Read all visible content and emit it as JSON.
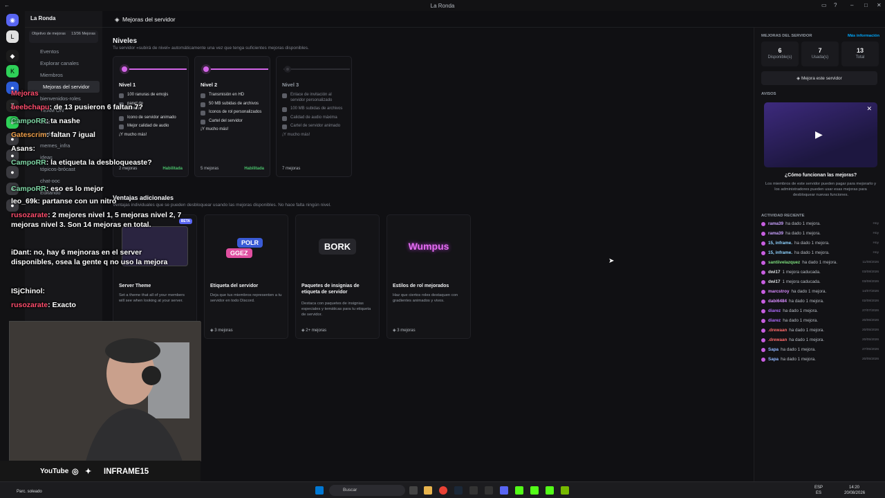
{
  "window": {
    "title": "La Ronda"
  },
  "rail": {
    "badge": "187"
  },
  "sidebar": {
    "server_name": "La Ronda",
    "goal_label": "Objetivo de mejoras",
    "goal_count": "13/36",
    "goal_unit": "Mejoras",
    "items": [
      "Eventos",
      "Explorar canales",
      "Miembros",
      "Mejoras del servidor",
      "bienvenidos-roles",
      "TEAM ON",
      "chat",
      "mods",
      "memes_infra",
      "ideas",
      "tópicos-brócast",
      "chat-ooc",
      "Editando"
    ]
  },
  "topbar": {
    "title": "Mejoras del servidor"
  },
  "levels_section": {
    "title": "Niveles",
    "subtitle": "Tu servidor «subirá de nivel» automáticamente una vez que tenga suficientes mejoras disponibles."
  },
  "levels": [
    {
      "name": "Nivel 1",
      "perks": [
        "100 ranuras de emojis",
        "sonidos",
        "Icono de servidor animado",
        "Mejor calidad de audio",
        "¡Y mucho más!"
      ],
      "perk_extra": "panel de",
      "cost": "2 mejoras",
      "status": "Habilitada"
    },
    {
      "name": "Nivel 2",
      "perks": [
        "Transmisión en HD",
        "50 MB subidas de archivos",
        "Iconos de rol personalizados",
        "Cartel del servidor",
        "¡Y mucho más!"
      ],
      "cost": "5 mejoras",
      "status": "Habilitada"
    },
    {
      "name": "Nivel 3",
      "perks": [
        "Enlace de invitación al servidor personalizado",
        "100 MB subidas de archivos",
        "Calidad de audio máxima",
        "Cartel de servidor animado",
        "¡Y mucho más!"
      ],
      "cost": "7 mejoras",
      "status": ""
    }
  ],
  "perks_section": {
    "title": "Ventajas adicionales",
    "subtitle": "Ventajas individuales que se pueden desbloquear usando las mejoras disponibles. No hace falta ningún nivel."
  },
  "perks": [
    {
      "title": "Server Theme",
      "desc": "Set a theme that all of your members will see when looking at your server.",
      "cost": "",
      "badge": "BETA"
    },
    {
      "title": "Etiqueta del servidor",
      "desc": "Deja que tus miembros representen a tu servidor en todo Discord.",
      "cost": "3 mejoras",
      "art": [
        "POLR",
        "GGEZ"
      ]
    },
    {
      "title": "Paquetes de insignias de etiqueta de servidor",
      "desc": "Destaca con paquetes de insignias especiales y temáticas para tu etiqueta de servidor.",
      "cost": "2+ mejoras",
      "art": [
        "BORK"
      ]
    },
    {
      "title": "Estilos de rol mejorados",
      "desc": "Haz que ciertos roles destaquen con gradientes animados y vivos.",
      "cost": "3 mejoras",
      "art": [
        "Wumpus"
      ]
    }
  ],
  "right": {
    "title": "MEJORAS DEL SERVIDOR",
    "more": "Más información",
    "stats": [
      {
        "n": "6",
        "l": "Disponible(s)"
      },
      {
        "n": "7",
        "l": "Usada(s)"
      },
      {
        "n": "13",
        "l": "Total"
      }
    ],
    "boost_btn": "Mejora este servidor",
    "ads_title": "AVISOS",
    "ad_title": "¿Cómo funcionan las mejoras?",
    "ad_text": "Los miembros de este servidor pueden pagar para mejorarlo y los administradores pueden usar esas mejoras para desbloquear nuevas funciones.",
    "activity_title": "ACTIVIDAD RECIENTE",
    "activity": [
      {
        "u": "rama39",
        "t": "ha dado 1 mejora.",
        "d": "Hoy",
        "c": "#c9a0ff"
      },
      {
        "u": "rama39",
        "t": "ha dado 1 mejora.",
        "d": "Hoy",
        "c": "#c9a0ff"
      },
      {
        "u": "15, inframe.",
        "t": "ha dado 1 mejora.",
        "d": "Hoy",
        "c": "#8fd3ff"
      },
      {
        "u": "15, inframe.",
        "t": "ha dado 1 mejora.",
        "d": "Hoy",
        "c": "#8fd3ff"
      },
      {
        "u": "santiivelazquez",
        "t": "ha dado 1 mejora.",
        "d": "11/08/2026",
        "c": "#7ee07e"
      },
      {
        "u": "dwi17",
        "t": "1 mejora caducada.",
        "d": "03/08/2026",
        "c": "#dbdee1"
      },
      {
        "u": "dwi17",
        "t": "1 mejora caducada.",
        "d": "03/08/2026",
        "c": "#dbdee1"
      },
      {
        "u": "marcstroy",
        "t": "ha dado 1 mejora.",
        "d": "14/07/2026",
        "c": "#d98cff"
      },
      {
        "u": "dabi6484",
        "t": "ha dado 1 mejora.",
        "d": "02/08/2026",
        "c": "#d98cff"
      },
      {
        "u": "diarez",
        "t": "ha dado 1 mejora.",
        "d": "27/07/2026",
        "c": "#b06bff"
      },
      {
        "u": "diarez",
        "t": "ha dado 1 mejora.",
        "d": "20/06/2026",
        "c": "#b06bff"
      },
      {
        "u": ".drewaan",
        "t": "ha dado 1 mejora.",
        "d": "20/05/2026",
        "c": "#ff6b6b"
      },
      {
        "u": ".drewaan",
        "t": "ha dado 1 mejora.",
        "d": "20/05/2026",
        "c": "#ff6b6b"
      },
      {
        "u": "Sapa",
        "t": "ha dado 1 mejora.",
        "d": "27/05/2026",
        "c": "#8fb6ff"
      },
      {
        "u": "Sapa",
        "t": "ha dado 1 mejora.",
        "d": "20/05/2026",
        "c": "#8fb6ff"
      }
    ]
  },
  "chat": [
    {
      "u": "Mejoras",
      "t": "",
      "c": "#ff4d6d"
    },
    {
      "u": "beebchapu",
      "t": ": de 13 pusieron 6 faltan 7?",
      "c": "#ff4d6d"
    },
    {
      "u": "CampoRR",
      "t": ": ta nashe",
      "c": "#7fd6a5"
    },
    {
      "u": "Gatescrim",
      "t": ": faltan 7 igual",
      "c": "#f0a04b"
    },
    {
      "u": "Asans",
      "t": ":",
      "c": "#ffffff"
    },
    {
      "u": "CampoRR",
      "t": ": la etiqueta la desbloqueaste?",
      "c": "#7fd6a5"
    },
    {
      "u": "CampoRR",
      "t": ": eso es lo mejor",
      "c": "#7fd6a5"
    },
    {
      "u": "leo_69k",
      "t": ": partanse con un nitro",
      "c": "#ffffff"
    },
    {
      "u": "rusozarate",
      "t": ": 2 mejores nivel 1, 5 mejoras nivel 2, 7 mejoras nivel 3. Son 14 mejoras en total.",
      "c": "#ff4d6d"
    },
    {
      "u": "iDant",
      "t": ": no, hay 6 mejnoras en el server disponibles, osea la gente q no uso la mejora",
      "c": "#ffffff"
    },
    {
      "u": "ISjChinol",
      "t": ":",
      "c": "#ffffff"
    },
    {
      "u": "rusozarate",
      "t": ": Exacto",
      "c": "#ff4d6d"
    }
  ],
  "social": {
    "youtube": "YouTube",
    "handle": "INFRAME15"
  },
  "taskbar": {
    "weather": "Parc. soleado",
    "search": "Buscar",
    "lang": "ESP",
    "lang2": "ES",
    "time": "14:20",
    "date": "20/08/2026"
  },
  "colors": {
    "accent": "#d365e8",
    "enabled": "#4ac26b"
  }
}
